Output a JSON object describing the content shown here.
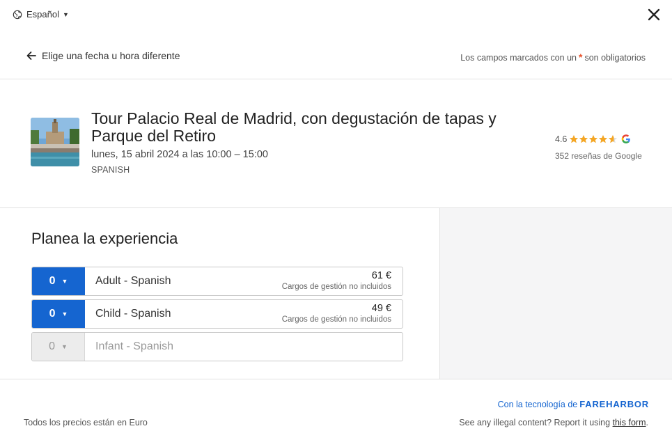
{
  "top_bar": {
    "language": "Español",
    "language_icon": "globe-icon",
    "close_icon": "close-icon"
  },
  "nav": {
    "back_label": "Elige una fecha u hora diferente",
    "required_note_prefix": "Los campos marcados con un",
    "required_star": "*",
    "required_note_suffix": "son obligatorios"
  },
  "item": {
    "title": "Tour Palacio Real de Madrid, con degustación de tapas y Parque del Retiro",
    "datetime": "lunes, 15 abril 2024 a las 10:00 – 15:00",
    "language": "SPANISH",
    "rating": "4.6",
    "rating_stars": 4.6,
    "reviews": "352 reseñas de Google",
    "colors": {
      "star": "#f5a623",
      "accent": "#1565d0"
    }
  },
  "plan": {
    "title": "Planea la experiencia",
    "tickets": [
      {
        "qty": "0",
        "name": "Adult - Spanish",
        "price": "61 €",
        "fees": "Cargos de gestión no incluidos",
        "enabled": true
      },
      {
        "qty": "0",
        "name": "Child - Spanish",
        "price": "49 €",
        "fees": "Cargos de gestión no incluidos",
        "enabled": true
      },
      {
        "qty": "0",
        "name": "Infant - Spanish",
        "price": "",
        "fees": "",
        "enabled": false
      }
    ]
  },
  "footer": {
    "powered_prefix": "Con la tecnología de",
    "powered_brand": "FAREHARBOR",
    "prices_note": "Todos los precios están en Euro",
    "illegal_prefix": "See any illegal content? Report it using",
    "illegal_link": "this form",
    "illegal_suffix": "."
  }
}
